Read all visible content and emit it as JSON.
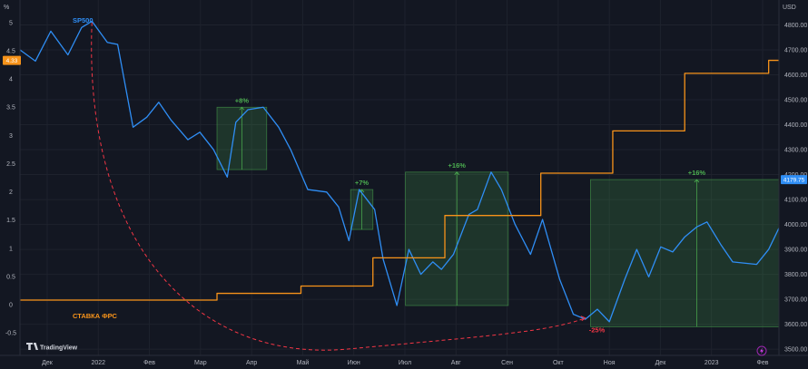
{
  "chart_data": {
    "type": "line",
    "left_axis": {
      "unit_label": "%",
      "ticks": [
        "5",
        "4.5",
        "4",
        "3.5",
        "3",
        "2.5",
        "2",
        "1.5",
        "1",
        "0.5",
        "0",
        "-0.5"
      ],
      "range": [
        -0.9,
        5.4
      ]
    },
    "right_axis": {
      "unit_label": "USD",
      "ticks": [
        "4800.00",
        "4700.00",
        "4600.00",
        "4500.00",
        "4400.00",
        "4300.00",
        "4200.00",
        "4100.00",
        "4000.00",
        "3900.00",
        "3800.00",
        "3700.00",
        "3600.00",
        "3500.00"
      ],
      "range": [
        3475,
        4900
      ]
    },
    "x_axis": {
      "tick_labels": [
        "Дек",
        "2022",
        "Фев",
        "Мар",
        "Апр",
        "Май",
        "Июн",
        "Июл",
        "Авг",
        "Сен",
        "Окт",
        "Ноя",
        "Дек",
        "2023",
        "Фев"
      ],
      "range": [
        "2021-11-22",
        "2023-02-08"
      ]
    },
    "series": [
      {
        "name": "SP500",
        "color": "#2f8ef5",
        "axis": "right",
        "points": [
          [
            "2021-11-22",
            4700
          ],
          [
            "2021-12-01",
            4655
          ],
          [
            "2021-12-10",
            4775
          ],
          [
            "2021-12-20",
            4680
          ],
          [
            "2021-12-28",
            4790
          ],
          [
            "2022-01-03",
            4815
          ],
          [
            "2022-01-12",
            4730
          ],
          [
            "2022-01-18",
            4722
          ],
          [
            "2022-01-27",
            4390
          ],
          [
            "2022-02-04",
            4430
          ],
          [
            "2022-02-11",
            4490
          ],
          [
            "2022-02-18",
            4420
          ],
          [
            "2022-02-28",
            4340
          ],
          [
            "2022-03-07",
            4370
          ],
          [
            "2022-03-15",
            4300
          ],
          [
            "2022-03-23",
            4190
          ],
          [
            "2022-03-28",
            4410
          ],
          [
            "2022-04-04",
            4460
          ],
          [
            "2022-04-13",
            4470
          ],
          [
            "2022-04-22",
            4390
          ],
          [
            "2022-04-29",
            4300
          ],
          [
            "2022-05-09",
            4140
          ],
          [
            "2022-05-20",
            4130
          ],
          [
            "2022-05-27",
            4070
          ],
          [
            "2022-06-02",
            3935
          ],
          [
            "2022-06-08",
            4140
          ],
          [
            "2022-06-17",
            4060
          ],
          [
            "2022-06-22",
            3860
          ],
          [
            "2022-06-30",
            3675
          ],
          [
            "2022-07-07",
            3900
          ],
          [
            "2022-07-14",
            3800
          ],
          [
            "2022-07-21",
            3850
          ],
          [
            "2022-07-26",
            3820
          ],
          [
            "2022-08-02",
            3880
          ],
          [
            "2022-08-11",
            4040
          ],
          [
            "2022-08-16",
            4060
          ],
          [
            "2022-08-24",
            4210
          ],
          [
            "2022-08-30",
            4140
          ],
          [
            "2022-09-07",
            4000
          ],
          [
            "2022-09-16",
            3880
          ],
          [
            "2022-09-23",
            4020
          ],
          [
            "2022-10-03",
            3780
          ],
          [
            "2022-10-11",
            3640
          ],
          [
            "2022-10-18",
            3620
          ],
          [
            "2022-10-25",
            3660
          ],
          [
            "2022-11-01",
            3610
          ],
          [
            "2022-11-10",
            3780
          ],
          [
            "2022-11-17",
            3900
          ],
          [
            "2022-11-24",
            3790
          ],
          [
            "2022-12-01",
            3910
          ],
          [
            "2022-12-08",
            3890
          ],
          [
            "2022-12-15",
            3950
          ],
          [
            "2022-12-22",
            3990
          ],
          [
            "2022-12-28",
            4010
          ],
          [
            "2023-01-05",
            3920
          ],
          [
            "2023-01-12",
            3850
          ],
          [
            "2023-01-19",
            3845
          ],
          [
            "2023-01-26",
            3840
          ],
          [
            "2023-02-02",
            3900
          ],
          [
            "2023-02-09",
            4000
          ],
          [
            "2023-02-16",
            3980
          ],
          [
            "2023-02-23",
            4070
          ],
          [
            "2023-03-01",
            4179.75
          ]
        ]
      },
      {
        "name": "СТАВКА ФРС",
        "color": "#f7931a",
        "axis": "left",
        "step": true,
        "points": [
          [
            "2021-11-22",
            0.08
          ],
          [
            "2022-03-17",
            0.2
          ],
          [
            "2022-05-05",
            0.33
          ],
          [
            "2022-06-16",
            0.83
          ],
          [
            "2022-07-28",
            1.58
          ],
          [
            "2022-09-22",
            2.33
          ],
          [
            "2022-11-03",
            3.08
          ],
          [
            "2022-12-15",
            4.1
          ],
          [
            "2023-02-02",
            4.33
          ]
        ],
        "end": "2023-02-26"
      }
    ],
    "last_value_badges": [
      {
        "axis": "left",
        "value": 4.33,
        "text": "4.33",
        "color": "#f7931a"
      },
      {
        "axis": "right",
        "value": 4179.75,
        "text": "4179.75",
        "color": "#2f8ef5"
      }
    ],
    "annotations": [
      {
        "type": "range-box",
        "x0": "2022-03-17",
        "x1": "2022-04-15",
        "y0": 4220,
        "y1": 4470,
        "label": "+8%",
        "color": "#4caf50"
      },
      {
        "type": "range-box",
        "x0": "2022-06-03",
        "x1": "2022-06-16",
        "y0": 3980,
        "y1": 4140,
        "label": "+7%",
        "color": "#4caf50"
      },
      {
        "type": "range-box",
        "x0": "2022-07-05",
        "x1": "2022-09-03",
        "y0": 3675,
        "y1": 4210,
        "label": "+16%",
        "color": "#4caf50"
      },
      {
        "type": "range-box",
        "x0": "2022-10-21",
        "x1": "2023-02-22",
        "y0": 3590,
        "y1": 4180,
        "label": "+16%",
        "color": "#4caf50"
      },
      {
        "type": "dashed-arc",
        "from": [
          "2022-01-03",
          4810
        ],
        "to": [
          "2022-10-18",
          3625
        ],
        "label": "-25%",
        "color": "#f23645"
      }
    ],
    "grid": true,
    "legend": "inline-labels",
    "branding": "TradingView"
  }
}
